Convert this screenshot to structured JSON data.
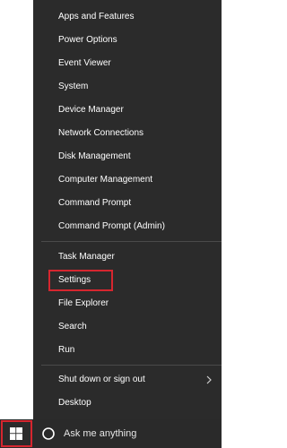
{
  "menu": {
    "items": [
      {
        "label": "Apps and Features"
      },
      {
        "label": "Power Options"
      },
      {
        "label": "Event Viewer"
      },
      {
        "label": "System"
      },
      {
        "label": "Device Manager"
      },
      {
        "label": "Network Connections"
      },
      {
        "label": "Disk Management"
      },
      {
        "label": "Computer Management"
      },
      {
        "label": "Command Prompt"
      },
      {
        "label": "Command Prompt (Admin)"
      },
      {
        "label": "Task Manager"
      },
      {
        "label": "Settings"
      },
      {
        "label": "File Explorer"
      },
      {
        "label": "Search"
      },
      {
        "label": "Run"
      },
      {
        "label": "Shut down or sign out"
      },
      {
        "label": "Desktop"
      }
    ]
  },
  "taskbar": {
    "start_icon": "windows-logo-icon",
    "search_icon": "cortana-circle-icon",
    "search_text": "Ask me anything"
  },
  "colors": {
    "menu_bg": "#2b2b2b",
    "taskbar_bg": "#1f1f1f",
    "highlight": "#d6262f",
    "text": "#ffffff"
  }
}
